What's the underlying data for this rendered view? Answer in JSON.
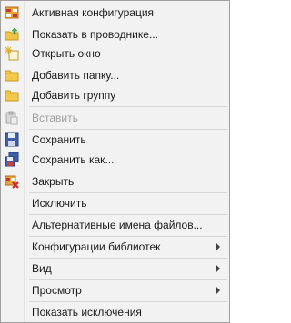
{
  "menu": {
    "items": [
      {
        "label": "Активная конфигурация",
        "icon": "active-config-icon"
      },
      {
        "label": "Показать в проводнике...",
        "icon": "folder-up-arrow-icon"
      },
      {
        "label": "Открыть окно",
        "icon": "new-window-sparkle-icon"
      },
      {
        "label": "Добавить папку...",
        "icon": "folder-icon"
      },
      {
        "label": "Добавить группу",
        "icon": "folder-icon"
      },
      {
        "label": "Вставить",
        "icon": "paste-icon",
        "disabled": true
      },
      {
        "label": "Сохранить",
        "icon": "save-icon"
      },
      {
        "label": "Сохранить как...",
        "icon": "save-as-icon"
      },
      {
        "label": "Закрыть",
        "icon": "close-config-icon"
      },
      {
        "label": "Исключить"
      },
      {
        "label": "Альтернативные имена файлов..."
      },
      {
        "label": "Конфигурации библиотек",
        "submenu": true
      },
      {
        "label": "Вид",
        "submenu": true
      },
      {
        "label": "Просмотр",
        "submenu": true
      },
      {
        "label": "Показать исключения"
      }
    ]
  }
}
